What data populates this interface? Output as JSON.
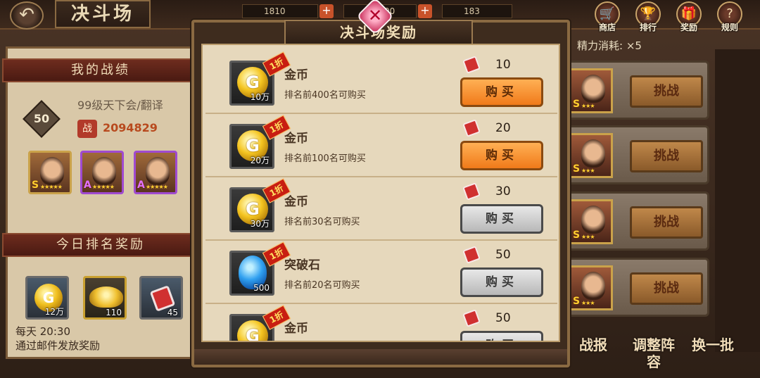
{
  "header": {
    "title": "决斗场",
    "resources": [
      "1810",
      "30/100",
      "183"
    ],
    "icons": [
      {
        "name": "shop",
        "label": "商店"
      },
      {
        "name": "rank",
        "label": "排行"
      },
      {
        "name": "reward",
        "label": "奖励"
      },
      {
        "name": "rules",
        "label": "规则"
      }
    ]
  },
  "left": {
    "record_title": "我的战绩",
    "level": "50",
    "player_name": "99级天下会/翻译",
    "power_badge": "战",
    "power": "2094829",
    "heroes": [
      {
        "grade": "S",
        "stars": "★★★★★"
      },
      {
        "grade": "A",
        "stars": "★★★★★"
      },
      {
        "grade": "A",
        "stars": "★★★★★"
      }
    ],
    "daily_title": "今日排名奖励",
    "daily_rewards": [
      {
        "icon": "gold-coin",
        "coin_letter": "G",
        "qty": "12万"
      },
      {
        "icon": "gold-ingot",
        "qty": "110"
      },
      {
        "icon": "duel-ticket",
        "qty": "45"
      }
    ],
    "daily_time": "每天 20:30",
    "daily_note": "通过邮件发放奖励"
  },
  "right": {
    "energy_label": "精力消耗: ×5",
    "challenge_label": "挑战",
    "opponent_grade": "S",
    "opponent_stars": "★★★",
    "bottom_buttons": [
      "战报",
      "调整阵容",
      "换一批"
    ]
  },
  "modal": {
    "title": "决斗场奖励",
    "discount_label": "1折",
    "buy_label": "购买",
    "items": [
      {
        "name": "金币",
        "icon": "gold-coin",
        "coin_letter": "G",
        "qty": "10万",
        "requirement": "排名前400名可购买",
        "price": "10",
        "enabled": true
      },
      {
        "name": "金币",
        "icon": "gold-coin",
        "coin_letter": "G",
        "qty": "20万",
        "requirement": "排名前100名可购买",
        "price": "20",
        "enabled": true
      },
      {
        "name": "金币",
        "icon": "gold-coin",
        "coin_letter": "G",
        "qty": "30万",
        "requirement": "排名前30名可购买",
        "price": "30",
        "enabled": false
      },
      {
        "name": "突破石",
        "icon": "breakthrough-stone",
        "coin_letter": "",
        "qty": "500",
        "requirement": "排名前20名可购买",
        "price": "50",
        "enabled": false
      },
      {
        "name": "金币",
        "icon": "gold-coin",
        "coin_letter": "G",
        "qty": "",
        "requirement": "",
        "price": "50",
        "enabled": false
      }
    ]
  },
  "colors": {
    "buy_enabled": "#f07a1a",
    "buy_disabled": "#b8b8b8",
    "modal_body": "#e6d8bc",
    "header_red": "#6e2c1e"
  }
}
